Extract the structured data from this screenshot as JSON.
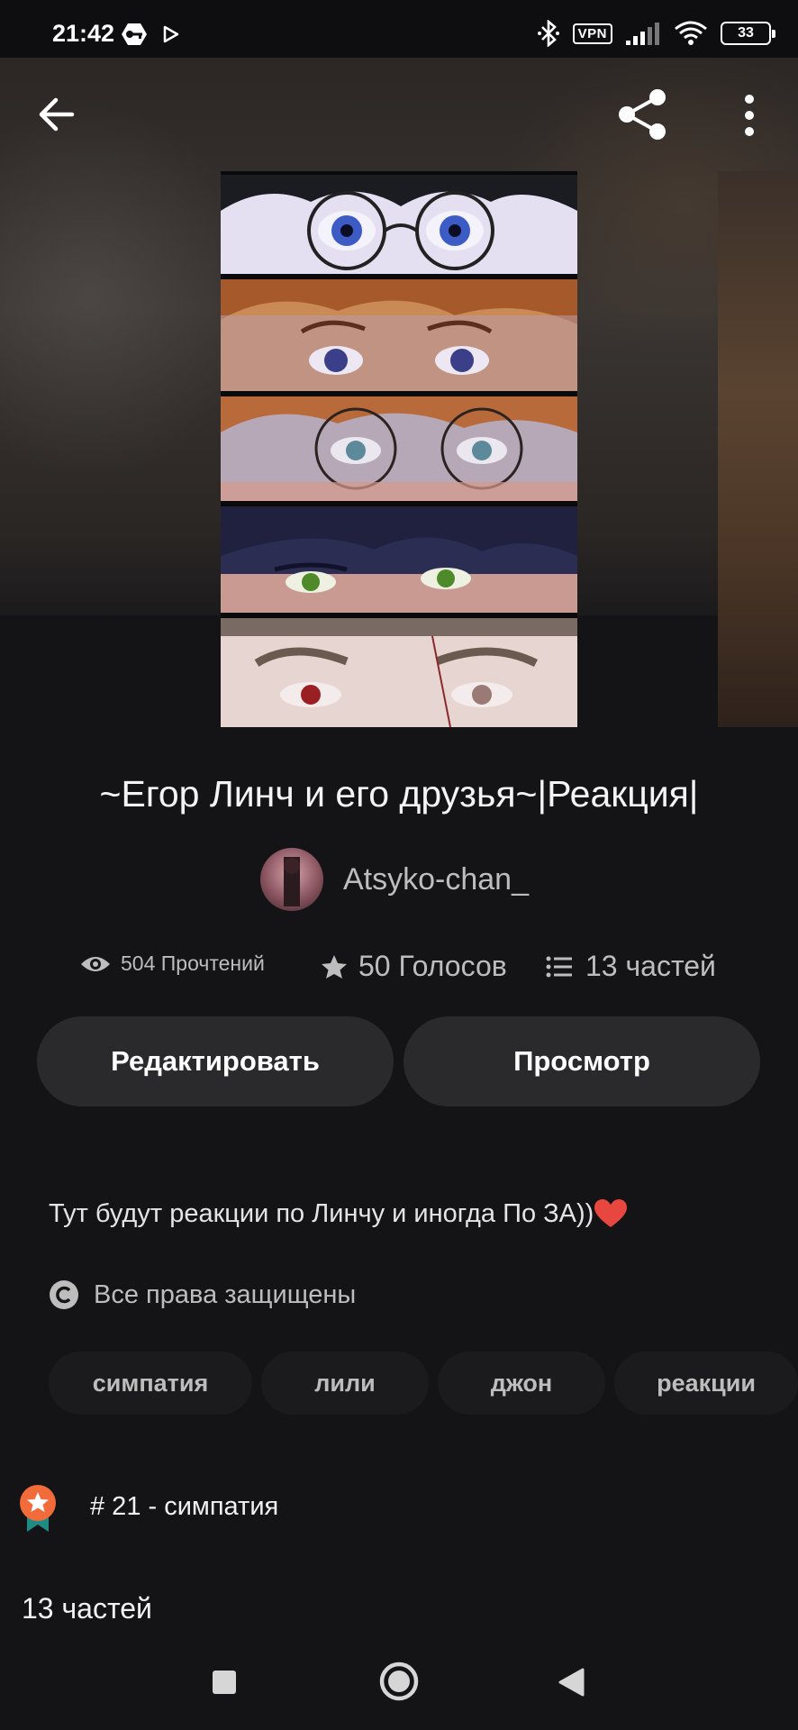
{
  "status_bar": {
    "time": "21:42",
    "vpn_label": "VPN",
    "battery": "33",
    "icons": [
      "key-app-icon",
      "play-icon",
      "bluetooth-icon",
      "vpn-icon",
      "signal-icon",
      "wifi-icon",
      "battery-icon"
    ]
  },
  "topbar": {
    "icons": [
      "back-arrow-icon",
      "share-icon",
      "more-vertical-icon"
    ]
  },
  "book": {
    "title": "~Егор Линч и его друзья~|Реакция|",
    "author": "Atsyko-chan_",
    "stats": {
      "reads": "504 Прочтений",
      "votes": "50 Голосов",
      "parts": "13 частей"
    },
    "description": "Тут будут реакции по Линчу и иногда По ЗА))",
    "rights": "Все права защищены",
    "tags": [
      "симпатия",
      "лили",
      "джон",
      "реакции"
    ],
    "rank": "# 21 - симпатия",
    "parts_heading": "13 частей"
  },
  "actions": {
    "edit_label": "Редактировать",
    "view_label": "Просмотр"
  },
  "colors": {
    "background": "#141316",
    "button": "#2a292c",
    "text_secondary": "#bdbdbd",
    "badge_orange": "#f26b3a",
    "badge_teal": "#1e8c85",
    "heart": "#e8473f"
  },
  "navbar": {
    "icons": [
      "recent-apps-icon",
      "home-icon",
      "back-triangle-icon"
    ]
  }
}
